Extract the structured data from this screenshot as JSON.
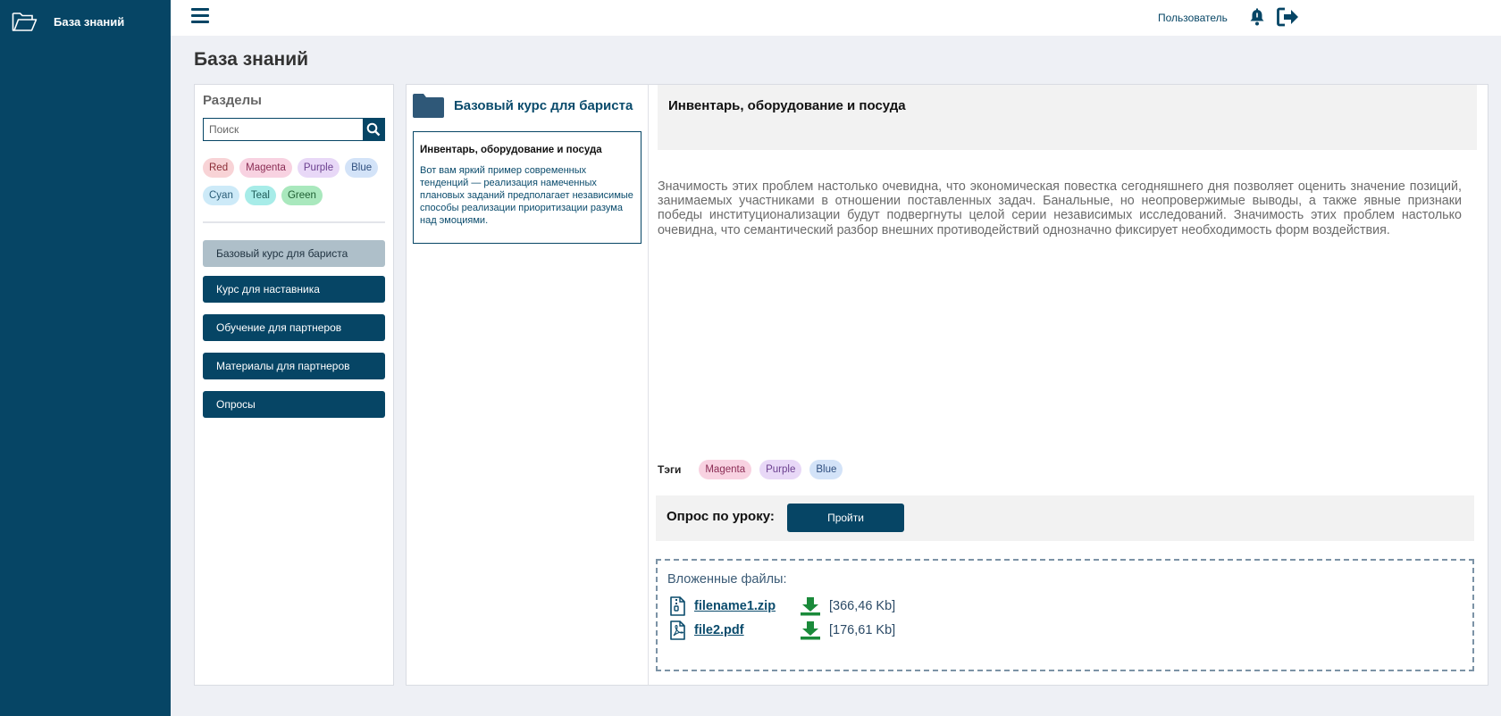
{
  "app": {
    "brand_label": "База знаний"
  },
  "topbar": {
    "user_label": "Пользователь"
  },
  "page": {
    "title": "База знаний"
  },
  "sections": {
    "title": "Разделы",
    "search_placeholder": "Поиск",
    "tags": [
      {
        "label": "Red",
        "bg": "#f8d3d6",
        "color": "#8b2d36"
      },
      {
        "label": "Magenta",
        "bg": "#f8d2e1",
        "color": "#8b2d55"
      },
      {
        "label": "Purple",
        "bg": "#e8d8f7",
        "color": "#6b3f8f"
      },
      {
        "label": "Blue",
        "bg": "#d3e3f8",
        "color": "#2f4f7f"
      },
      {
        "label": "Cyan",
        "bg": "#cdeaf8",
        "color": "#2a5d78"
      },
      {
        "label": "Teal",
        "bg": "#a7ece8",
        "color": "#1d5b58"
      },
      {
        "label": "Green",
        "bg": "#a9e8bd",
        "color": "#1f5f33"
      }
    ],
    "items": [
      {
        "label": "Базовый курс для бариста",
        "active": true
      },
      {
        "label": "Курс для наставника",
        "active": false
      },
      {
        "label": "Обучение для партнеров",
        "active": false
      },
      {
        "label": "Материалы для партнеров",
        "active": false
      },
      {
        "label": "Опросы",
        "active": false
      }
    ]
  },
  "course": {
    "title": "Базовый курс для бариста",
    "lesson_card": {
      "title": "Инвентарь, оборудование и посуда",
      "text": "Вот вам яркий пример современных тенденций — реализация намеченных плановых заданий предполагает независимые способы реализации приоритизации разума над эмоциями."
    }
  },
  "lesson": {
    "title": "Инвентарь, оборудование и посуда",
    "body": "Значимость этих проблем настолько очевидна, что экономическая повестка сегодняшнего дня позволяет оценить значение позиций, занимаемых участниками в отношении поставленных задач. Банальные, но неопровержимые выводы, а также явные признаки победы институционализации будут подвергнуты целой серии независимых исследований. Значимость этих проблем настолько очевидна, что семантический разбор внешних противодействий однозначно фиксирует необходимость форм воздействия.",
    "tags_label": "Тэги",
    "tags": [
      {
        "label": "Magenta",
        "bg": "#f8d2e1",
        "color": "#8b2d55"
      },
      {
        "label": "Purple",
        "bg": "#e8d8f7",
        "color": "#6b3f8f"
      },
      {
        "label": "Blue",
        "bg": "#d3e3f8",
        "color": "#2f4f7f"
      }
    ],
    "survey_label": "Опрос по уроку:",
    "survey_button": "Пройти",
    "files_label": "Вложенные файлы:",
    "files": [
      {
        "name": "filename1.zip",
        "size": "[366,46 Kb]",
        "icon": "zip-file-icon"
      },
      {
        "name": "file2.pdf",
        "size": "[176,61 Kb]",
        "icon": "pdf-file-icon"
      }
    ]
  },
  "colors": {
    "primary": "#064565",
    "active_nav": "#aebfc9",
    "download": "#1a8a3a"
  }
}
